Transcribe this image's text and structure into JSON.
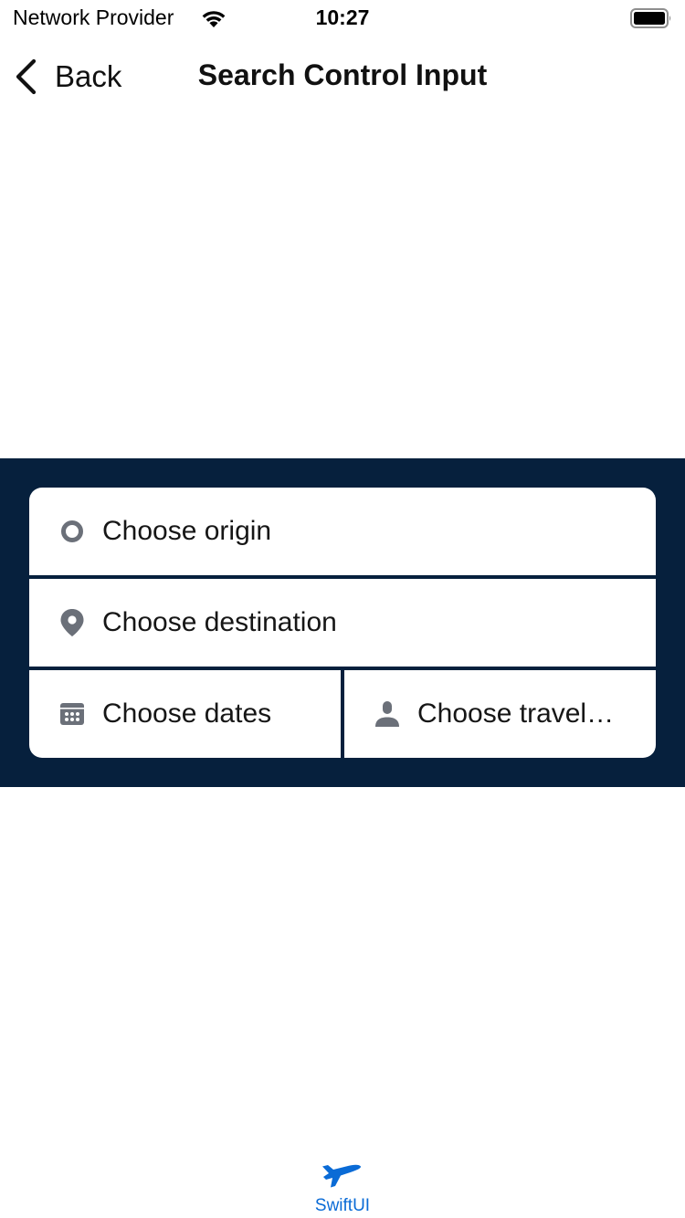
{
  "status_bar": {
    "carrier": "Network Provider",
    "time": "10:27",
    "wifi_icon": "wifi-icon",
    "battery_icon": "battery-icon"
  },
  "nav": {
    "back_label": "Back",
    "title": "Search Control Input"
  },
  "search": {
    "background_color": "#06203d",
    "origin": {
      "label": "Choose origin",
      "icon": "origin-circle-icon"
    },
    "destination": {
      "label": "Choose destination",
      "icon": "map-pin-icon"
    },
    "dates": {
      "label": "Choose dates",
      "icon": "calendar-icon"
    },
    "travelers": {
      "label": "Choose travel…",
      "icon": "person-icon"
    }
  },
  "tab_bar": {
    "items": [
      {
        "label": "SwiftUI",
        "icon": "airplane-icon",
        "selected": true,
        "color": "#0a6bd6"
      }
    ]
  }
}
